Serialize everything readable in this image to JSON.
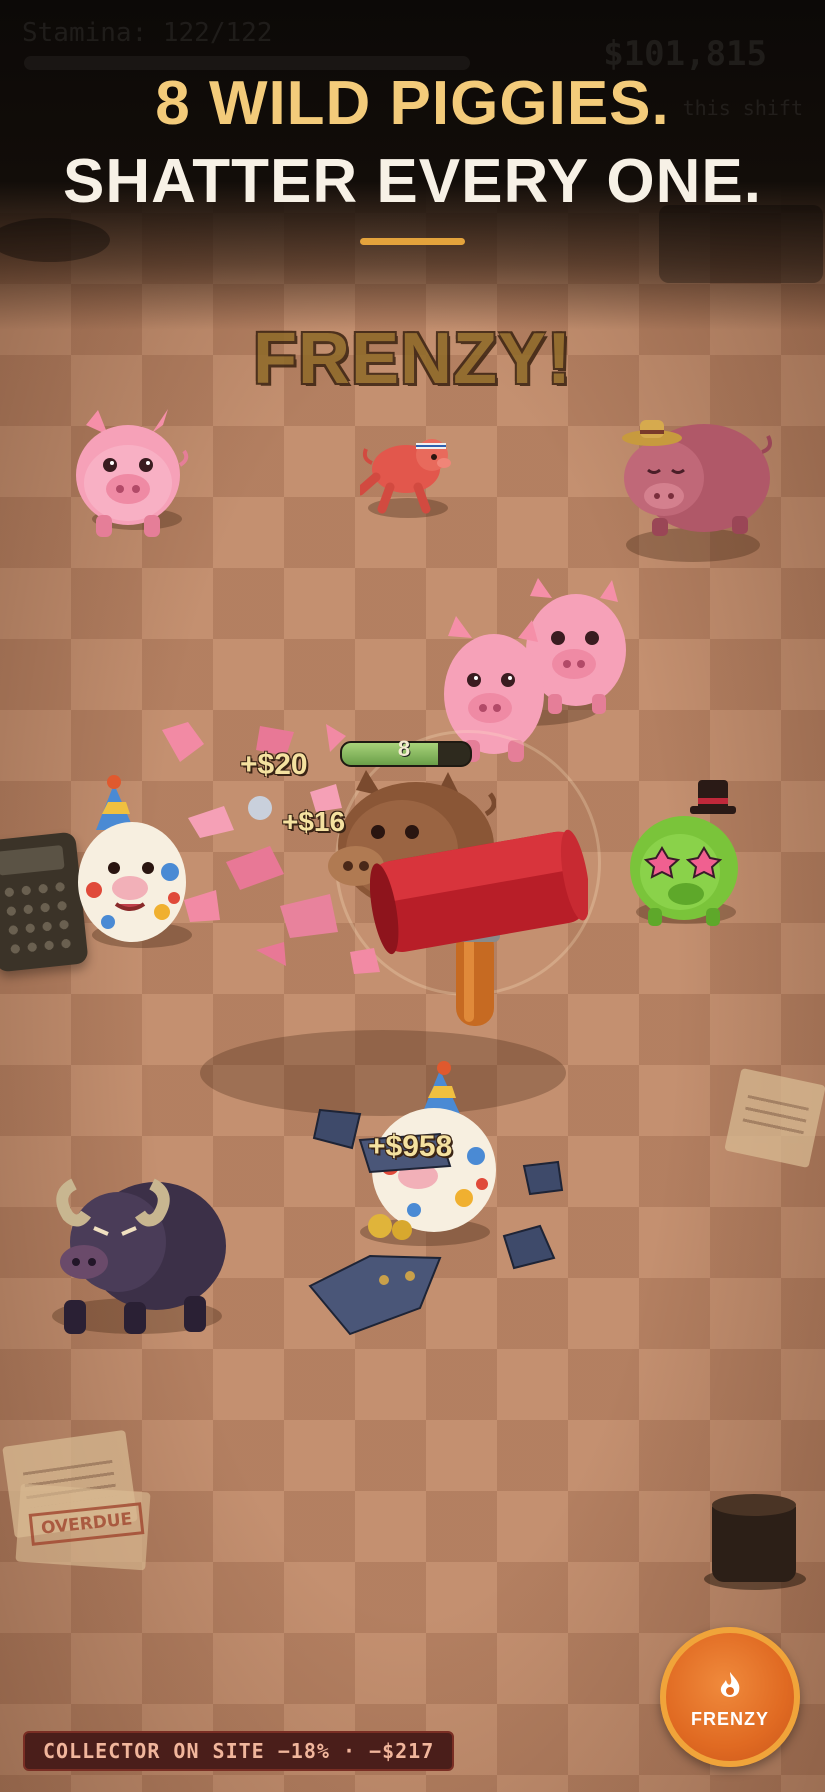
{
  "hud": {
    "stamina_label": "Stamina: 122/122",
    "money": "$101,815",
    "shift_label": "this shift"
  },
  "headline": {
    "line1": "8 WILD PIGGIES.",
    "line2": "SHATTER EVERY ONE."
  },
  "banner": "FRENZY!",
  "target_pig": {
    "hp_label": "8",
    "hp_fraction": 0.75
  },
  "floating_rewards": [
    "+$20",
    "+$16",
    "+$958"
  ],
  "props": {
    "overdue_stamp": "OVERDUE"
  },
  "frenzy_button": {
    "label": "FRENZY",
    "icon": "flame-icon"
  },
  "status_bar": {
    "text": "COLLECTOR ON SITE −18% · −$217"
  },
  "colors": {
    "headline_gold": "#f3cb7a",
    "headline_white": "#f7f1e6",
    "frenzy_orange": "#e06a22",
    "status_bg": "#4a1e1a"
  }
}
